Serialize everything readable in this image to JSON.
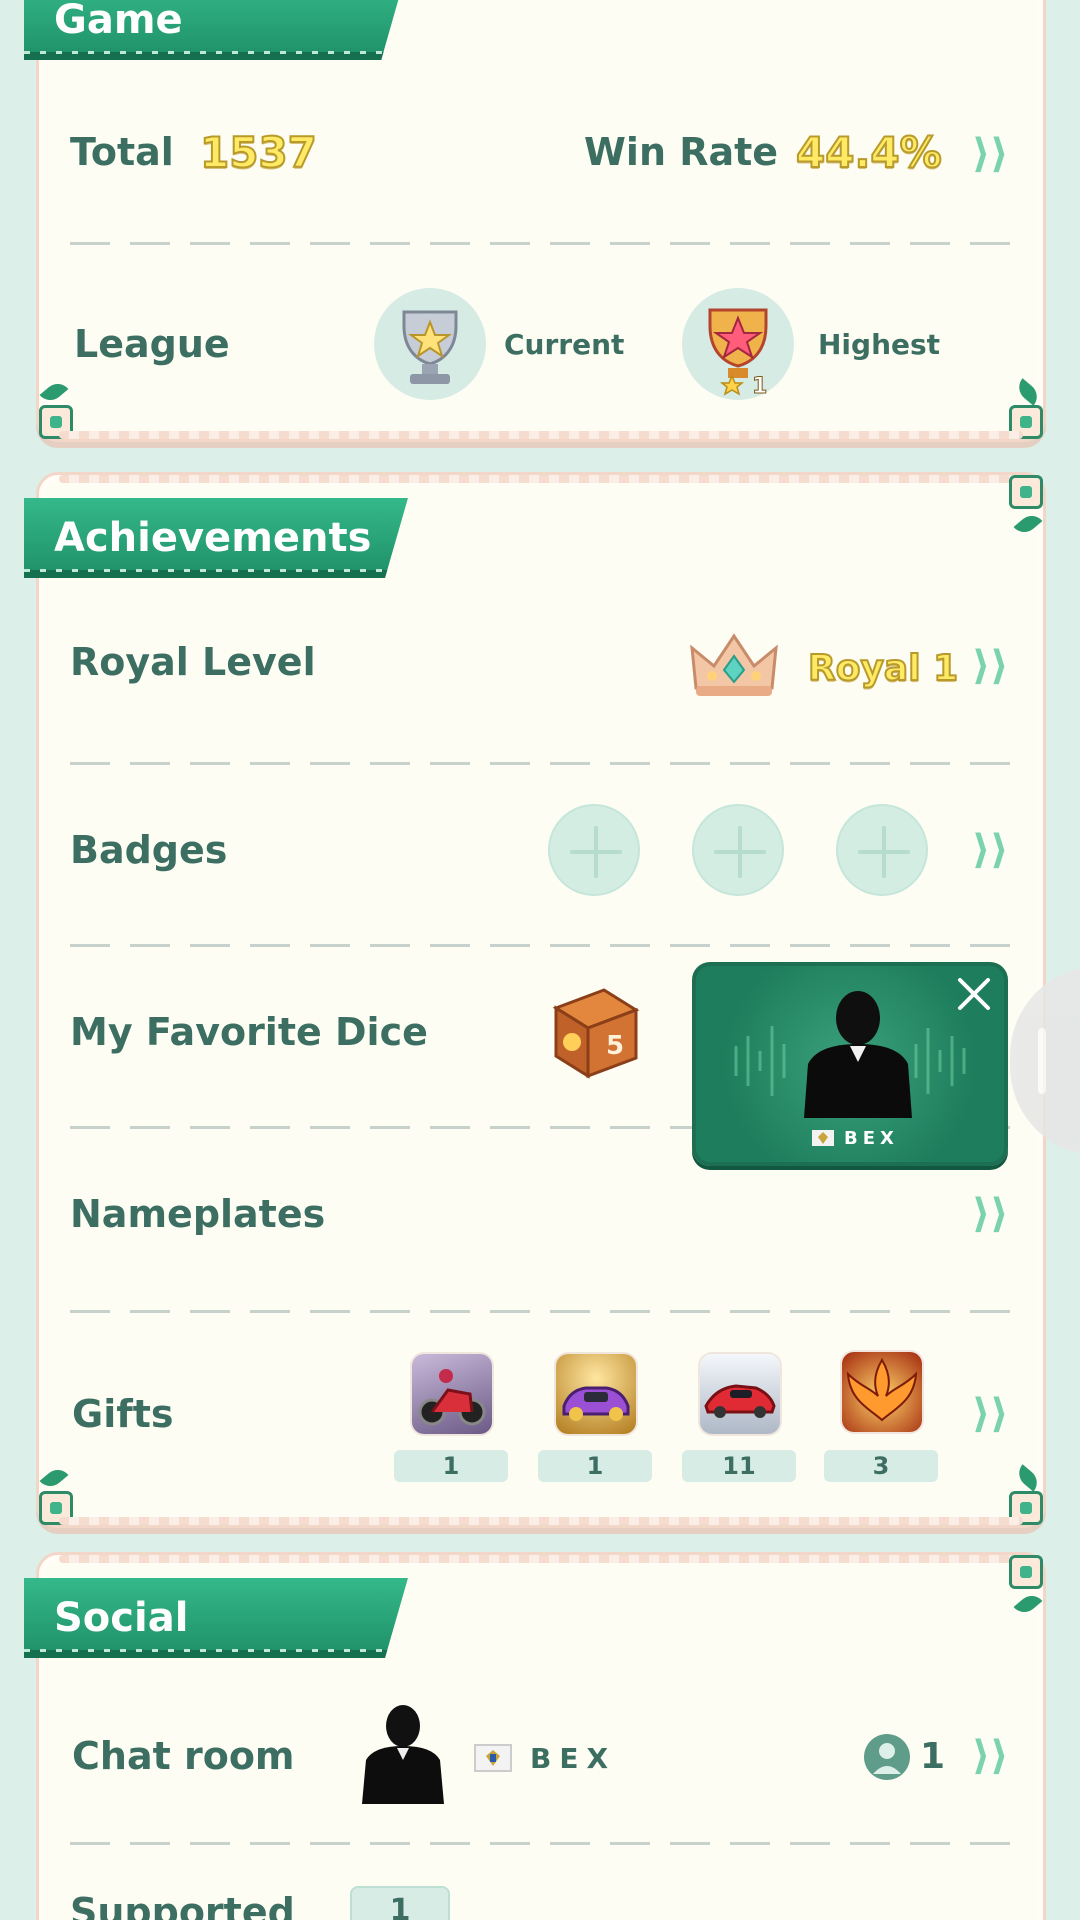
{
  "game": {
    "title": "Game",
    "total_label": "Total",
    "total_value": "1537",
    "win_rate_label": "Win Rate",
    "win_rate_value": "44.4%",
    "league_label": "League",
    "current_label": "Current",
    "highest_label": "Highest",
    "highest_star_count": "1"
  },
  "achievements": {
    "title": "Achievements",
    "royal_level_label": "Royal Level",
    "royal_level_value": "Royal 1",
    "badges_label": "Badges",
    "favorite_dice_label": "My Favorite Dice",
    "nameplates_label": "Nameplates",
    "gifts_label": "Gifts",
    "gifts": [
      {
        "icon": "motorcycle-gift-icon",
        "count": "1"
      },
      {
        "icon": "purple-car-gift-icon",
        "count": "1"
      },
      {
        "icon": "red-sports-car-gift-icon",
        "count": "11"
      },
      {
        "icon": "phoenix-gift-icon",
        "count": "3"
      }
    ]
  },
  "popup": {
    "name": "BEX"
  },
  "social": {
    "title": "Social",
    "chat_room_label": "Chat room",
    "chat_room_name": "BEX",
    "member_count": "1",
    "supported_label": "Supported",
    "supported_count": "1"
  },
  "colors": {
    "accent_green": "#1f8f67",
    "label_green": "#3c6e61",
    "gold": "#ffea66",
    "background": "#dcefe8"
  }
}
